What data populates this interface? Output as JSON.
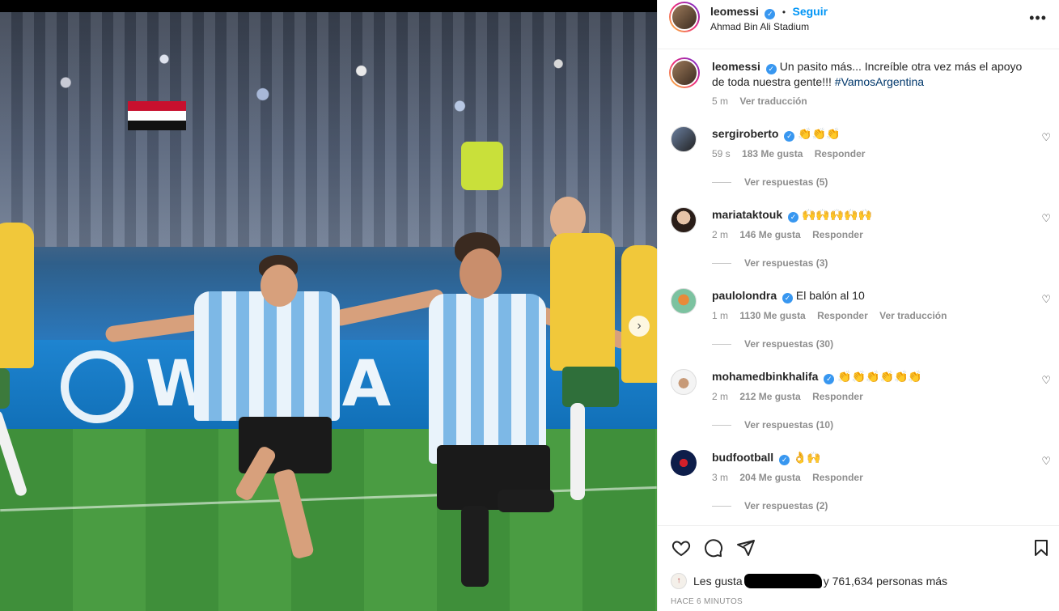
{
  "post": {
    "author": "leomessi",
    "follow_label": "Seguir",
    "dot": "•",
    "location": "Ahmad Bin Ali Stadium",
    "verified_icon": "verified-badge-icon",
    "caption": "Un pasito más... Increíble otra vez más el apoyo de toda nuestra gente!!! ",
    "hashtag": "#VamosArgentina",
    "caption_time": "5 m",
    "translate_label": "Ver traducción",
    "more_icon": "•••"
  },
  "photo": {
    "ad_text": "WA  DA"
  },
  "comments": [
    {
      "user": "sergiroberto",
      "text": "👏👏👏",
      "time": "59 s",
      "likes": "183 Me gusta",
      "reply": "Responder",
      "translate": "",
      "replies": "Ver respuestas (5)"
    },
    {
      "user": "mariataktouk",
      "text": "🙌🙌🙌🙌🙌",
      "time": "2 m",
      "likes": "146 Me gusta",
      "reply": "Responder",
      "translate": "",
      "replies": "Ver respuestas (3)"
    },
    {
      "user": "paulolondra",
      "text": "El balón al 10",
      "time": "1 m",
      "likes": "1130 Me gusta",
      "reply": "Responder",
      "translate": "Ver traducción",
      "replies": "Ver respuestas (30)"
    },
    {
      "user": "mohamedbinkhalifa",
      "text": "👏👏👏👏👏👏",
      "time": "2 m",
      "likes": "212 Me gusta",
      "reply": "Responder",
      "translate": "",
      "replies": "Ver respuestas (10)"
    },
    {
      "user": "budfootball",
      "text": "👌🙌",
      "time": "3 m",
      "likes": "204 Me gusta",
      "reply": "Responder",
      "translate": "",
      "replies": "Ver respuestas (2)"
    }
  ],
  "actions": {
    "like_icon": "heart-icon",
    "comment_icon": "comment-icon",
    "share_icon": "share-icon",
    "save_icon": "bookmark-icon"
  },
  "likes": {
    "prefix": "Les gusta",
    "suffix": "y 761,634 personas más"
  },
  "date": "HACE 6 MINUTOS",
  "colors": {
    "accent": "#0095f6",
    "verified": "#3897f0",
    "muted": "#8e8e8e",
    "hashtag": "#00376b"
  }
}
